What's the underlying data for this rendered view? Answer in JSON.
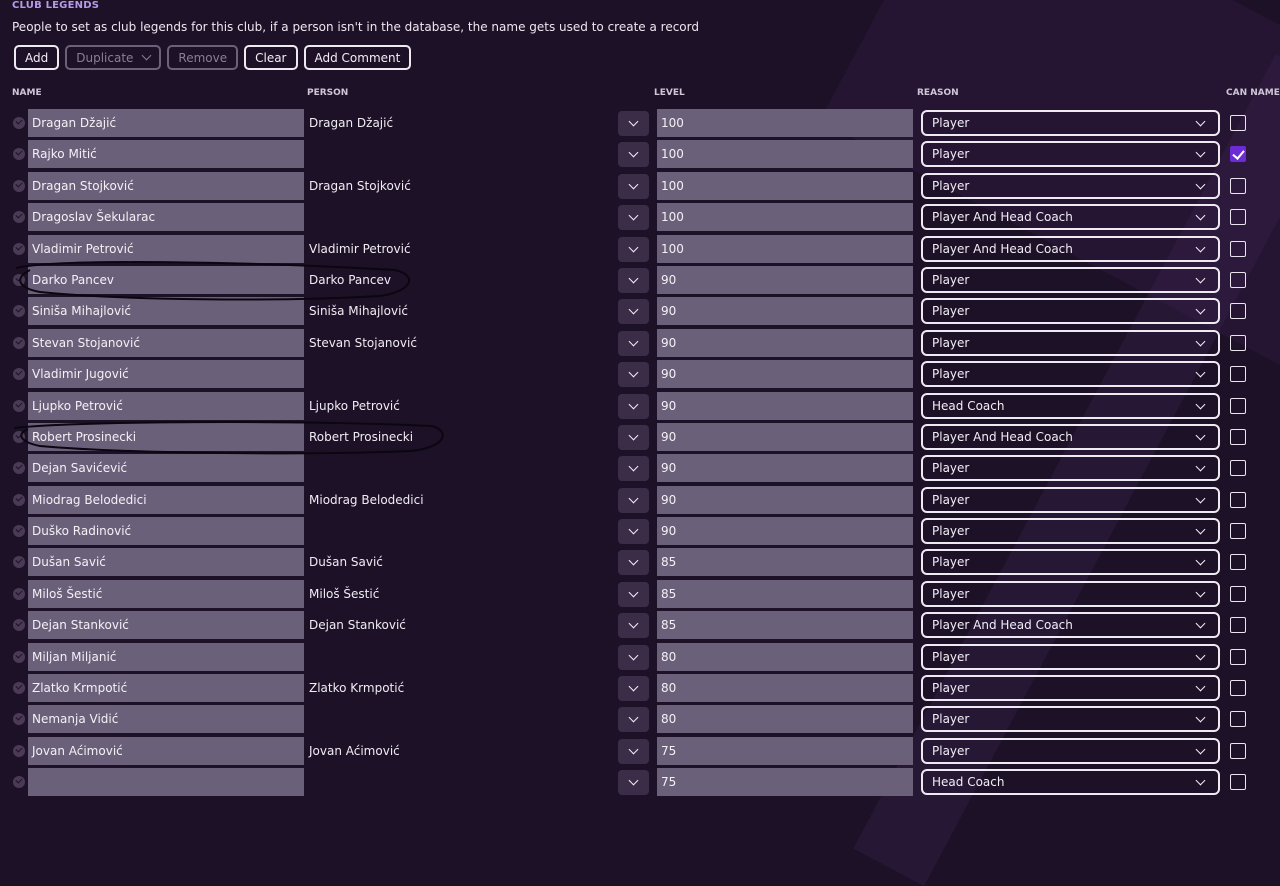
{
  "section_title": "CLUB LEGENDS",
  "description": "People to set as club legends for this club, if a person isn't in the database, the name gets used to create a record",
  "toolbar": {
    "add": "Add",
    "duplicate": "Duplicate",
    "remove": "Remove",
    "clear": "Clear",
    "add_comment": "Add Comment"
  },
  "headers": {
    "name": "NAME",
    "person": "PERSON",
    "level": "LEVEL",
    "reason": "REASON",
    "can_name": "CAN NAME C"
  },
  "rows": [
    {
      "name": "Dragan Džajić",
      "person": "Dragan Džajić",
      "level": "100",
      "reason": "Player",
      "can_name": false
    },
    {
      "name": "Rajko Mitić",
      "person": "",
      "level": "100",
      "reason": "Player",
      "can_name": true
    },
    {
      "name": "Dragan Stojković",
      "person": "Dragan Stojković",
      "level": "100",
      "reason": "Player",
      "can_name": false
    },
    {
      "name": "Dragoslav Šekularac",
      "person": "",
      "level": "100",
      "reason": "Player And Head Coach",
      "can_name": false
    },
    {
      "name": "Vladimir Petrović",
      "person": "Vladimir Petrović",
      "level": "100",
      "reason": "Player And Head Coach",
      "can_name": false
    },
    {
      "name": "Darko Pancev",
      "person": "Darko Pancev",
      "level": "90",
      "reason": "Player",
      "can_name": false
    },
    {
      "name": "Siniša Mihajlović",
      "person": "Siniša Mihajlović",
      "level": "90",
      "reason": "Player",
      "can_name": false
    },
    {
      "name": "Stevan Stojanović",
      "person": "Stevan Stojanović",
      "level": "90",
      "reason": "Player",
      "can_name": false
    },
    {
      "name": "Vladimir Jugović",
      "person": "",
      "level": "90",
      "reason": "Player",
      "can_name": false
    },
    {
      "name": "Ljupko Petrović",
      "person": "Ljupko Petrović",
      "level": "90",
      "reason": "Head Coach",
      "can_name": false
    },
    {
      "name": "Robert Prosinecki",
      "person": "Robert Prosinecki",
      "level": "90",
      "reason": "Player And Head Coach",
      "can_name": false
    },
    {
      "name": "Dejan Savićević",
      "person": "",
      "level": "90",
      "reason": "Player",
      "can_name": false
    },
    {
      "name": "Miodrag Belodedici",
      "person": "Miodrag Belodedici",
      "level": "90",
      "reason": "Player",
      "can_name": false
    },
    {
      "name": "Duško Radinović",
      "person": "",
      "level": "90",
      "reason": "Player",
      "can_name": false
    },
    {
      "name": "Dušan Savić",
      "person": "Dušan Savić",
      "level": "85",
      "reason": "Player",
      "can_name": false
    },
    {
      "name": "Miloš Šestić",
      "person": "Miloš Šestić",
      "level": "85",
      "reason": "Player",
      "can_name": false
    },
    {
      "name": "Dejan Stanković",
      "person": "Dejan Stanković",
      "level": "85",
      "reason": "Player And Head Coach",
      "can_name": false
    },
    {
      "name": "Miljan Miljanić",
      "person": "",
      "level": "80",
      "reason": "Player",
      "can_name": false
    },
    {
      "name": "Zlatko Krmpotić",
      "person": "Zlatko Krmpotić",
      "level": "80",
      "reason": "Player",
      "can_name": false
    },
    {
      "name": "Nemanja Vidić",
      "person": "",
      "level": "80",
      "reason": "Player",
      "can_name": false
    },
    {
      "name": "Jovan Aćimović",
      "person": "Jovan Aćimović",
      "level": "75",
      "reason": "Player",
      "can_name": false
    },
    {
      "name": "",
      "person": "",
      "level": "75",
      "reason": "Head Coach",
      "can_name": false
    }
  ]
}
